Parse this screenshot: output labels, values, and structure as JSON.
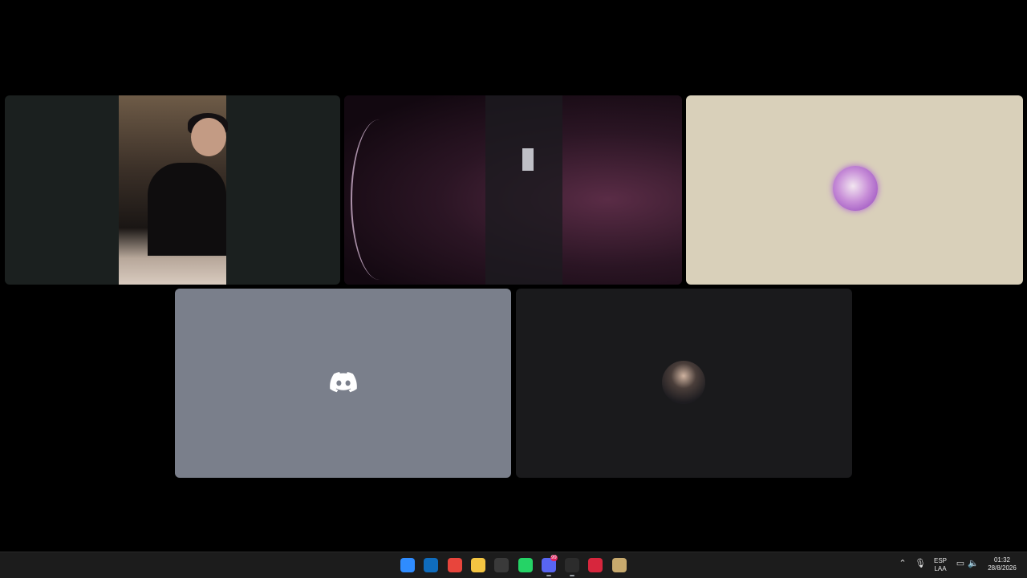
{
  "call": {
    "tiles": [
      {
        "id": "participant-webcam-1",
        "type": "video"
      },
      {
        "id": "participant-webcam-2",
        "type": "video"
      },
      {
        "id": "participant-avatar-anime",
        "type": "avatar",
        "bg": "#d9d0ba"
      },
      {
        "id": "participant-discord-default",
        "type": "avatar",
        "bg": "#7a7f8b"
      },
      {
        "id": "participant-avatar-photo",
        "type": "avatar",
        "bg": "#1a1a1c"
      }
    ]
  },
  "taskbar": {
    "apps": [
      {
        "name": "start-icon",
        "color": "#2f8cff"
      },
      {
        "name": "outlook-icon",
        "color": "#0f6cbd"
      },
      {
        "name": "chrome-icon",
        "color": "#e8453c"
      },
      {
        "name": "file-explorer-icon",
        "color": "#f4c542"
      },
      {
        "name": "app-cube-icon",
        "color": "#3a3a3a"
      },
      {
        "name": "whatsapp-icon",
        "color": "#25d366"
      },
      {
        "name": "discord-icon",
        "color": "#5865f2",
        "badge": "99"
      },
      {
        "name": "obs-icon",
        "color": "#2c2c2c"
      },
      {
        "name": "red-app-icon",
        "color": "#d7263d"
      },
      {
        "name": "league-icon",
        "color": "#c8aa6e"
      }
    ],
    "tray": {
      "language_top": "ESP",
      "language_bottom": "LAA",
      "time": "01:32",
      "date": "28/8/2026"
    }
  },
  "colors": {
    "background": "#000000",
    "taskbar": "#1c1c1c",
    "discord_blurple": "#5865f2"
  }
}
